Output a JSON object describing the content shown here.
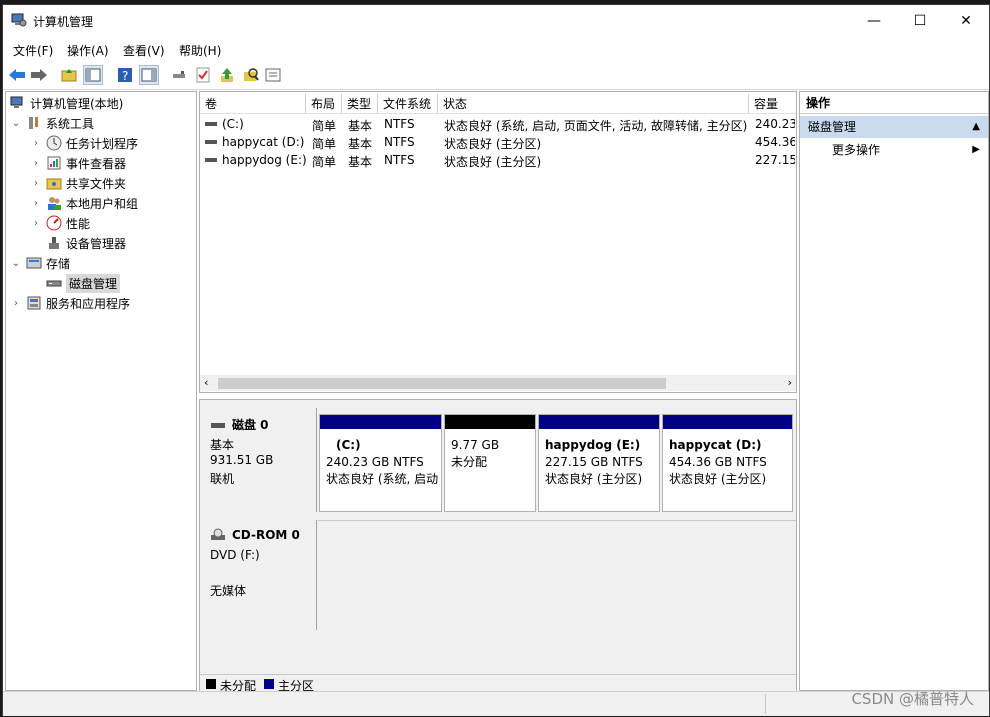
{
  "window": {
    "title": "计算机管理",
    "minimize_glyph": "—",
    "maximize_glyph": "☐",
    "close_glyph": "✕"
  },
  "menu": [
    "文件(F)",
    "操作(A)",
    "查看(V)",
    "帮助(H)"
  ],
  "tree": {
    "root": "计算机管理(本地)",
    "system_tools": "系统工具",
    "task_scheduler": "任务计划程序",
    "event_viewer": "事件查看器",
    "shared_folders": "共享文件夹",
    "local_users": "本地用户和组",
    "performance": "性能",
    "device_manager": "设备管理器",
    "storage": "存储",
    "disk_management": "磁盘管理",
    "services": "服务和应用程序"
  },
  "volume_list": {
    "columns": [
      "卷",
      "布局",
      "类型",
      "文件系统",
      "状态",
      "容量"
    ],
    "rows": [
      {
        "volume": "(C:)",
        "layout": "简单",
        "type": "基本",
        "fs": "NTFS",
        "status": "状态良好 (系统, 启动, 页面文件, 活动, 故障转储, 主分区)",
        "capacity": "240.23"
      },
      {
        "volume": "happycat (D:)",
        "layout": "简单",
        "type": "基本",
        "fs": "NTFS",
        "status": "状态良好 (主分区)",
        "capacity": "454.36"
      },
      {
        "volume": "happydog (E:)",
        "layout": "简单",
        "type": "基本",
        "fs": "NTFS",
        "status": "状态良好 (主分区)",
        "capacity": "227.15"
      }
    ]
  },
  "disk0": {
    "name": "磁盘 0",
    "type": "基本",
    "size": "931.51 GB",
    "state": "联机",
    "partitions": [
      {
        "name": "(C:)",
        "size": "240.23 GB NTFS",
        "status": "状态良好 (系统, 启动",
        "color": "#000080"
      },
      {
        "name": "",
        "size": "9.77 GB",
        "status": "未分配",
        "color": "#000000"
      },
      {
        "name": "happydog  (E:)",
        "size": "227.15 GB NTFS",
        "status": "状态良好 (主分区)",
        "color": "#000080"
      },
      {
        "name": "happycat  (D:)",
        "size": "454.36 GB NTFS",
        "status": "状态良好 (主分区)",
        "color": "#000080"
      }
    ]
  },
  "cdrom0": {
    "name": "CD-ROM 0",
    "drive": "DVD (F:)",
    "media": "无媒体"
  },
  "legend": {
    "unallocated": "未分配",
    "primary": "主分区",
    "unallocated_color": "#000000",
    "primary_color": "#000080"
  },
  "actions": {
    "header": "操作",
    "section": "磁盘管理",
    "more": "更多操作"
  },
  "watermark": "CSDN @橘普特人"
}
